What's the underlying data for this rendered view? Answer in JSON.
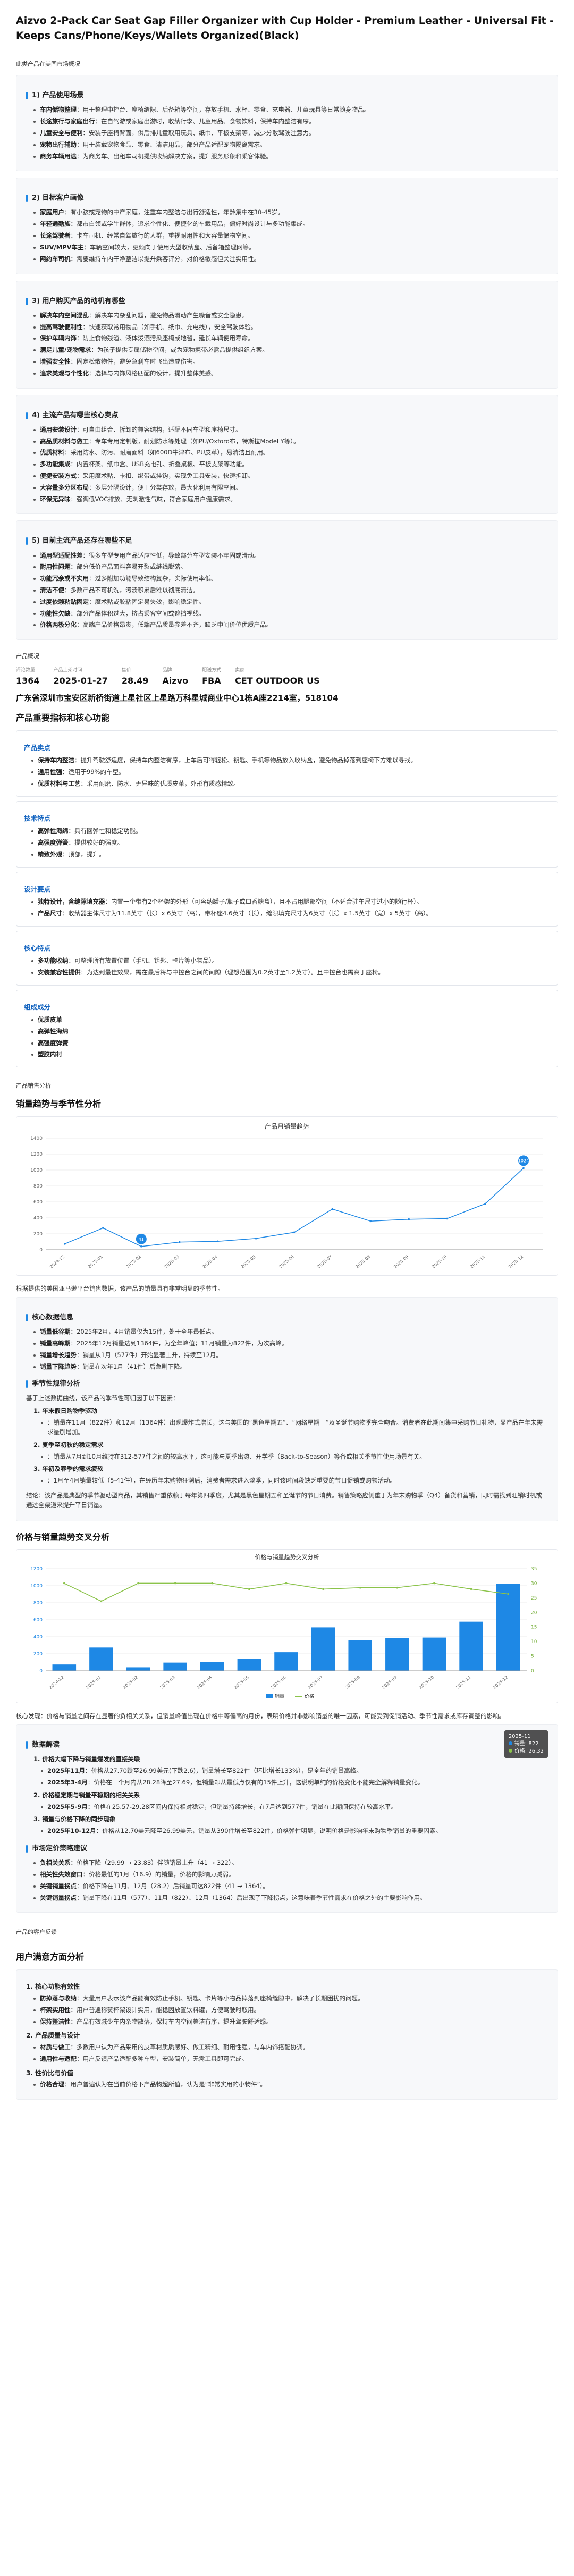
{
  "title": "Aizvo 2-Pack Car Seat Gap Filler Organizer with Cup Holder - Premium Leather - Universal Fit - Keeps Cans/Phone/Keys/Wallets Organized(Black)",
  "intro_label": "此类产品在美国市场概况",
  "intro_sections": [
    {
      "heading": "1) 产品使用场景",
      "items": [
        {
          "k": "车内储物整理",
          "v": "用于整理中控台、座椅缝隙、后备箱等空间，存放手机、水杯、零食、充电器、儿童玩具等日常随身物品。"
        },
        {
          "k": "长途旅行与家庭出行",
          "v": "在自驾游或家庭出游时，收纳行李、儿童用品、食物饮料，保持车内整洁有序。"
        },
        {
          "k": "儿童安全与便利",
          "v": "安装于座椅背面，供后排儿童取用玩具、纸巾、平板支架等，减少分散驾驶注意力。"
        },
        {
          "k": "宠物出行辅助",
          "v": "用于装载宠物食品、零食、清洁用品，部分产品适配宠物隔离需求。"
        },
        {
          "k": "商务车辆用途",
          "v": "为商务车、出租车司机提供收纳解决方案，提升服务形象和乘客体验。"
        }
      ]
    },
    {
      "heading": "2) 目标客户画像",
      "items": [
        {
          "k": "家庭用户",
          "v": "有小孩或宠物的中产家庭，注重车内整洁与出行舒适性，年龄集中在30-45岁。"
        },
        {
          "k": "年轻通勤族",
          "v": "都市白领或学生群体，追求个性化、便捷化的车载用品，偏好时尚设计与多功能集成。"
        },
        {
          "k": "长途驾驶者",
          "v": "卡车司机、经常自驾旅行的人群，重视耐用性和大容量储物空间。"
        },
        {
          "k": "SUV/MPV车主",
          "v": "车辆空间较大，更倾向于使用大型收纳盒、后备箱整理网等。"
        },
        {
          "k": "网约车司机",
          "v": "需要维持车内干净整洁以提升乘客评分，对价格敏感但关注实用性。"
        }
      ]
    },
    {
      "heading": "3) 用户购买产品的动机有哪些",
      "items": [
        {
          "k": "解决车内空间混乱",
          "v": "解决车内杂乱问题，避免物品滑动产生噪音或安全隐患。"
        },
        {
          "k": "提高驾驶便利性",
          "v": "快速获取常用物品（如手机、纸巾、充电线），安全驾驶体验。"
        },
        {
          "k": "保护车辆内饰",
          "v": "防止食物残渣、液体泼洒污染座椅或地毯，延长车辆使用寿命。"
        },
        {
          "k": "满足儿童/宠物需求",
          "v": "为孩子提供专属储物空间，或为宠物携带必需品提供组织方案。"
        },
        {
          "k": "增强安全性",
          "v": "固定松散物件，避免急刹车时飞出造成伤害。"
        },
        {
          "k": "追求美观与个性化",
          "v": "选择与内饰风格匹配的设计，提升整体美感。"
        }
      ]
    },
    {
      "heading": "4) 主流产品有哪些核心卖点",
      "items": [
        {
          "k": "通用安装设计",
          "v": "可自由组合、拆卸的兼容结构，适配不同车型和座椅尺寸。"
        },
        {
          "k": "高品质材料与做工",
          "v": "专车专用定制版，耐划防水等处理（如PU/Oxford布，特斯拉Model Y等）。"
        },
        {
          "k": "优质材料",
          "v": "采用防水、防污、耐磨面料（如600D牛津布、PU皮革），易清洁且耐用。"
        },
        {
          "k": "多功能集成",
          "v": "内置杯架、纸巾盒、USB充电孔、折叠桌板、平板支架等功能。"
        },
        {
          "k": "便捷安装方式",
          "v": "采用魔术贴、卡扣、绑带或挂钩，实现免工具安装，快速拆卸。"
        },
        {
          "k": "大容量多分区布局",
          "v": "多层分隔设计，便于分类存放，最大化利用有限空间。"
        },
        {
          "k": "环保无异味",
          "v": "强调低VOC排放、无刺激性气味，符合家庭用户健康需求。"
        }
      ]
    },
    {
      "heading": "5) 目前主流产品还存在哪些不足",
      "items": [
        {
          "k": "通用型适配性差",
          "v": "很多车型专用产品适应性低，导致部分车型安装不牢固或滑动。"
        },
        {
          "k": "耐用性问题",
          "v": "部分低价产品面料容易开裂或缝线脱落。"
        },
        {
          "k": "功能冗余或不实用",
          "v": "过多附加功能导致结构复杂，实际使用率低。"
        },
        {
          "k": "清洁不便",
          "v": "多数产品不可机洗，污渍积累后难以彻底清洁。"
        },
        {
          "k": "过度依赖粘贴固定",
          "v": "魔术贴或胶粘固定易失效，影响稳定性。"
        },
        {
          "k": "功能性欠缺",
          "v": "部分产品体积过大，挤占乘客空间或遮挡视线。"
        },
        {
          "k": "价格两极分化",
          "v": "高端产品价格昂贵，低端产品质量参差不齐，缺乏中间价位优质产品。"
        }
      ]
    }
  ],
  "overview_label": "产品概况",
  "stats": [
    {
      "label": "评论数量",
      "value": "1364"
    },
    {
      "label": "产品上架时间",
      "value": "2025-01-27"
    },
    {
      "label": "售价",
      "value": "28.49"
    },
    {
      "label": "品牌",
      "value": "Aizvo"
    },
    {
      "label": "配送方式",
      "value": "FBA"
    },
    {
      "label": "卖家",
      "value": "CET OUTDOOR US"
    }
  ],
  "address": "广东省深圳市宝安区新桥街道上星社区上星路万科星城商业中心1栋A座2214室，518104",
  "metrics_title": "产品重要指标和核心功能",
  "metrics": [
    {
      "heading": "产品卖点",
      "items": [
        {
          "k": "保持车内整洁",
          "v": "提升驾驶舒适度，保持车内整洁有序，上车后可得轻松、钥匙、手机等物品放入收纳盒，避免物品掉落到座椅下方难以寻找。"
        },
        {
          "k": "通用性强",
          "v": "适用于99%的车型。"
        },
        {
          "k": "优质材料与工艺",
          "v": "采用耐磨、防水、无异味的优质皮革，外形有质感精致。"
        }
      ]
    },
    {
      "heading": "技术特点",
      "items": [
        {
          "k": "高弹性海绵",
          "v": "具有回弹性和稳定功能。"
        },
        {
          "k": "高强度弹簧",
          "v": "提供较好的强度。"
        },
        {
          "k": "精致外观",
          "v": "顶部，提升。"
        }
      ]
    },
    {
      "heading": "设计要点",
      "items": [
        {
          "k": "独特设计，含缝隙填充器",
          "v": "内置一个带有2个杯架的外形（可容纳罐子/瓶子或口香糖盒），且不占用腿部空间（不适合驻车尺寸过小的随行杯）。"
        },
        {
          "k": "产品尺寸",
          "v": "收纳器主体尺寸为11.8英寸（长）x 6英寸（高），带杯座4.6英寸（长），缝隙填充尺寸为6英寸（长）x 1.5英寸（宽）x 5英寸（高）。"
        }
      ]
    },
    {
      "heading": "核心特点",
      "items": [
        {
          "k": "多功能收纳",
          "v": "可整理所有放置位置（手机、钥匙、卡片等小物品）。"
        },
        {
          "k": "安装兼容性提供",
          "v": "为达到最佳效果，需在最后将与中控台之间的间隙（理想范围为0.2英寸至1.2英寸）。且中控台也需高于座椅。"
        }
      ]
    },
    {
      "heading": "组成成分",
      "items": [
        {
          "k": "优质皮革",
          "v": ""
        },
        {
          "k": "高弹性海绵",
          "v": ""
        },
        {
          "k": "高强度弹簧",
          "v": ""
        },
        {
          "k": "塑胶内衬",
          "v": ""
        }
      ]
    }
  ],
  "sales_section_label": "产品销售分析",
  "sales_trend_title": "销量趋势与季节性分析",
  "chart1": {
    "title": "产品月销量趋势",
    "categories": [
      "2024-12",
      "2025-01",
      "2025-02",
      "2025-03",
      "2025-04",
      "2025-05",
      "2025-06",
      "2025-07",
      "2025-08",
      "2025-09",
      "2025-10",
      "2025-11",
      "2025-12"
    ],
    "values": [
      74,
      273,
      41,
      96,
      105,
      142,
      218,
      510,
      358,
      382,
      390,
      577,
      1024
    ],
    "ylim": [
      0,
      1400
    ],
    "yticks": [
      0,
      200,
      400,
      600,
      800,
      1000,
      1200,
      1400
    ],
    "markers": [
      {
        "index": 2,
        "label": "41"
      },
      {
        "index": 12,
        "label": "1024"
      }
    ]
  },
  "trend_intro": "根据提供的美国亚马逊平台销售数据，该产品的销量具有非常明显的季节性。",
  "trend_core_heading": "核心数据信息",
  "trend_core_items": [
    {
      "k": "销量低谷期",
      "v": "2025年2月，4月销量仅为15件，处于全年最低点。"
    },
    {
      "k": "销量高峰期",
      "v": "2025年12月销量达到1364件，为全年峰值；11月销量为822件，为次高峰。"
    },
    {
      "k": "销量增长趋势",
      "v": "销量从1月（577件）开始显著上升，持续至12月。"
    },
    {
      "k": "销量下降趋势",
      "v": "销量在次年1月（41件）后急剧下降。"
    }
  ],
  "seasonal_heading": "季节性规律分析",
  "seasonal_intro": "基于上述数据曲线，该产品的季节性可归因于以下因素：",
  "seasonal_items": [
    {
      "title": "1. 年末假日购物季驱动",
      "subs": [
        {
          "k": "",
          "v": "销量在11月（822件）和12月（1364件）出现爆炸式增长，这与美国的“黑色星期五”、“网络星期一”及圣诞节购物季完全吻合。消费者在此期间集中采购节日礼物，显产品在年末需求量剧增加。"
        }
      ]
    },
    {
      "title": "2. 夏季至初秋的稳定需求",
      "subs": [
        {
          "k": "",
          "v": "销量从7月到10月维持在312-577件之间的较高水平，这可能与夏季出游、开学季（Back-to-Season）等备或相关季节性使用场景有关。"
        }
      ]
    },
    {
      "title": "3. 年初及春季的需求疲软",
      "subs": [
        {
          "k": "",
          "v": "1月至4月销量较低（5-41件），在经历年末购物狂潮后，消费者需求进入淡季，同时该时间段缺乏重要的节日促销或购物活动。"
        }
      ]
    }
  ],
  "trend_conclusion": "结论：该产品是典型的季节驱动型商品，其销售严重依赖于每年第四季度，尤其是黑色星期五和圣诞节的节日消费。销售策略应侧重于为年末购物季（Q4）备货和营销，同时需找到旺销时机或通过全渠道来提升平日销量。",
  "price_section_title": "价格与销量趋势交叉分析",
  "chart2": {
    "title": "价格与销量趋势交叉分析",
    "categories": [
      "2024-12",
      "2025-01",
      "2025-02",
      "2025-03",
      "2025-04",
      "2025-05",
      "2025-06",
      "2025-07",
      "2025-08",
      "2025-09",
      "2025-10",
      "2025-11",
      "2025-12"
    ],
    "sales": [
      74,
      273,
      41,
      96,
      105,
      142,
      218,
      510,
      358,
      382,
      390,
      577,
      1024
    ],
    "price": [
      29.99,
      23.83,
      29.99,
      29.99,
      29.99,
      27.99,
      29.99,
      27.99,
      28.49,
      28.49,
      29.99,
      28.02,
      26.32
    ],
    "ylim_left": [
      0,
      1200
    ],
    "yticks_left": [
      0,
      200,
      400,
      600,
      800,
      1000,
      1200
    ],
    "ylim_right": [
      0,
      35
    ],
    "yticks_right": [
      0,
      5,
      10,
      15,
      20,
      25,
      30,
      35
    ],
    "legend": [
      "销量",
      "价格"
    ],
    "tooltip": {
      "title": "2025-11",
      "sales_label": "销量: 822",
      "price_label": "价格: 26.32"
    }
  },
  "price_core": "核心发现：价格与销量之间存在显著的负相关关系，但销量峰值出现在价格中等偏高的月份，表明价格并非影响销量的唯一因素，可能受到促销活动、季节性需求或库存调整的影响。",
  "price_evidence_heading": "数据解读",
  "price_evidence": [
    {
      "title": "1. 价格大幅下降与销量爆发的直接关联",
      "subs": [
        {
          "k": "2025年11月",
          "v": "价格从27.70跌至26.99美元(下跌2.6)，销量增长至822件（环比增长133%），是全年的销量高峰。"
        },
        {
          "k": "2025年3-4月",
          "v": "价格在一个月内从28.28降至27.69，但销量却从最低点仅有的15件上升，这说明单纯的价格变化不能完全解释销量变化。"
        }
      ]
    },
    {
      "title": "2. 价格稳定期与销量平稳期的相关关系",
      "subs": [
        {
          "k": "2025年5-9月",
          "v": "价格在25.57-29.28区间内保持相对稳定，但销量持续增长，在7月达到577件，销量在此期间保持在较高水平。"
        }
      ]
    },
    {
      "title": "3. 销量与价格下降的同步现象",
      "subs": [
        {
          "k": "2025年10-12月",
          "v": "价格从12.70美元降至26.99美元，销量从390件增长至822件，价格弹性明显，说明价格是影响年末购物季销量的重要因素。"
        }
      ]
    }
  ],
  "price_market_heading": "市场定价策略建议",
  "price_market_items": [
    {
      "k": "负相关关系",
      "v": "价格下降（29.99 → 23.83）伴随销量上升（41 → 322）。"
    },
    {
      "k": "相关性失效窗口",
      "v": "价格最低的1月（16.9）的销量，价格的影响力减弱。"
    },
    {
      "k": "关键销量拐点",
      "v": "价格下降在11月、12月（28.2）后销量可达822件（41 → 1364）。"
    },
    {
      "k": "关键销量拐点",
      "v": "销量下降在11月（577）、11月（822）、12月（1364）后出现了下降拐点，这意味着季节性需求在价格之外的主要影响作用。"
    }
  ],
  "customer_section_label": "产品的客户反馈",
  "satisfaction_title": "用户满意方面分析",
  "satisfaction_groups": [
    {
      "title": "1. 核心功能有效性",
      "items": [
        {
          "k": "防掉落与收纳",
          "v": "大量用户表示该产品能有效防止手机、钥匙、卡片等小物品掉落到座椅缝隙中，解决了长期困扰的问题。"
        },
        {
          "k": "杯架实用性",
          "v": "用户普遍称赞杯架设计实用，能稳固放置饮料罐，方便驾驶时取用。"
        },
        {
          "k": "保持整洁性",
          "v": "产品有效减少车内杂物散落，保持车内空间整洁有序，提升驾驶舒适感。"
        }
      ]
    },
    {
      "title": "2. 产品质量与设计",
      "items": [
        {
          "k": "材质与做工",
          "v": "多数用户认为产品采用的皮革材质质感好、做工精细、耐用性强，与车内饰搭配协调。"
        },
        {
          "k": "通用性与适配",
          "v": "用户反馈产品适配多种车型，安装简单，无需工具即可完成。"
        }
      ]
    },
    {
      "title": "3. 性价比与价值",
      "items": [
        {
          "k": "价格合理",
          "v": "用户普遍认为在当前价格下产品物超所值，认为是“非常实用的小物件”。"
        }
      ]
    }
  ]
}
